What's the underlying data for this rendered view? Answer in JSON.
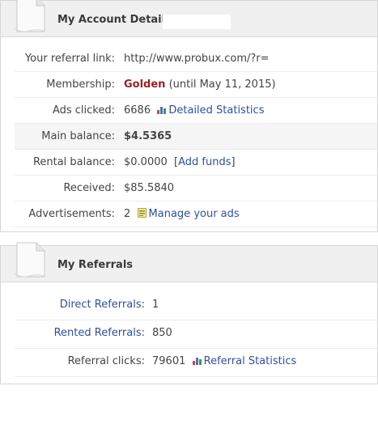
{
  "colors": {
    "accent_link": "#2f4f9f",
    "membership_red": "#9c1f1f",
    "balance_green": "#1e7f1e"
  },
  "account": {
    "title": "My Account Details:",
    "referral_link_label": "Your referral link:",
    "referral_link_value": "http://www.probux.com/?r=",
    "membership_label": "Membership:",
    "membership_level": "Golden",
    "membership_until": "(until May 11, 2015)",
    "ads_clicked_label": "Ads clicked:",
    "ads_clicked_value": "6686",
    "detailed_stats_link": "Detailed Statistics",
    "main_balance_label": "Main balance:",
    "main_balance_value": "$4.5365",
    "rental_balance_label": "Rental balance:",
    "rental_balance_value": "$0.0000",
    "add_funds_open": "[",
    "add_funds_link": "Add funds",
    "add_funds_close": "]",
    "received_label": "Received:",
    "received_value": "$85.5840",
    "advertisements_label": "Advertisements:",
    "advertisements_value": "2",
    "manage_ads_link": "Manage your ads"
  },
  "referrals": {
    "title": "My Referrals",
    "direct_label": "Direct Referrals",
    "direct_colon": ":",
    "direct_value": "1",
    "rented_label": "Rented Referrals",
    "rented_colon": ":",
    "rented_value": "850",
    "clicks_label": "Referral clicks:",
    "clicks_value": "79601",
    "referral_stats_link": "Referral Statistics"
  },
  "icons": {
    "header": "document-icon",
    "stats": "bar-chart-icon",
    "ads": "ads-icon"
  }
}
